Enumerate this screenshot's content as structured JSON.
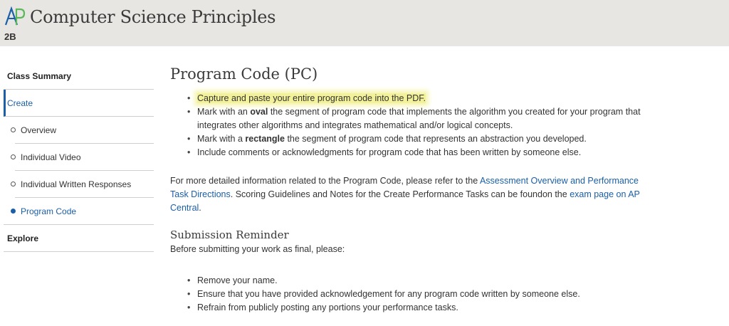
{
  "header": {
    "logo_text": "AP",
    "title": "Computer Science Principles",
    "class_code": "2B",
    "colors": {
      "background": "#e8e6e2",
      "logo_blue": "#1a5fa8",
      "logo_green": "#5cb85c"
    }
  },
  "sidebar": {
    "items": [
      {
        "label": "Class Summary"
      },
      {
        "label": "Create"
      }
    ],
    "sub_items": [
      {
        "label": "Overview"
      },
      {
        "label": "Individual Video"
      },
      {
        "label": "Individual Written Responses"
      },
      {
        "label": "Program Code"
      }
    ],
    "bottom_item": {
      "label": "Explore"
    }
  },
  "main": {
    "title": "Program Code (PC)",
    "requirements": [
      {
        "text": "Capture and paste your entire program code into the PDF."
      },
      {
        "pre": "Mark with an ",
        "bold": "oval",
        "post": " the segment of program code that implements the algorithm you created for your program that integrates other algorithms and integrates mathematical and/or logical concepts."
      },
      {
        "pre": "Mark with a ",
        "bold": "rectangle",
        "post": " the segment of program code that represents an abstraction you developed."
      },
      {
        "text": "Include comments or acknowledgments for program code that has been written by someone else."
      }
    ],
    "info": {
      "t1": "For more detailed information related to the Program Code, please refer to the ",
      "link1": "Assessment Overview and Performance Task Directions",
      "t2": ". Scoring Guidelines and Notes for the Create Performance Tasks can be foundon the ",
      "link2": "exam page on AP Central",
      "t3": "."
    },
    "reminder": {
      "heading": "Submission Reminder",
      "intro": "Before submitting your work as final, please:",
      "items": [
        "Remove your name.",
        "Ensure that you have provided acknowledgement for any program code written by someone else.",
        "Refrain from publicly posting any portions your performance tasks."
      ]
    },
    "colors": {
      "link": "#1a5fa8",
      "highlight": "#f3f29a"
    }
  }
}
